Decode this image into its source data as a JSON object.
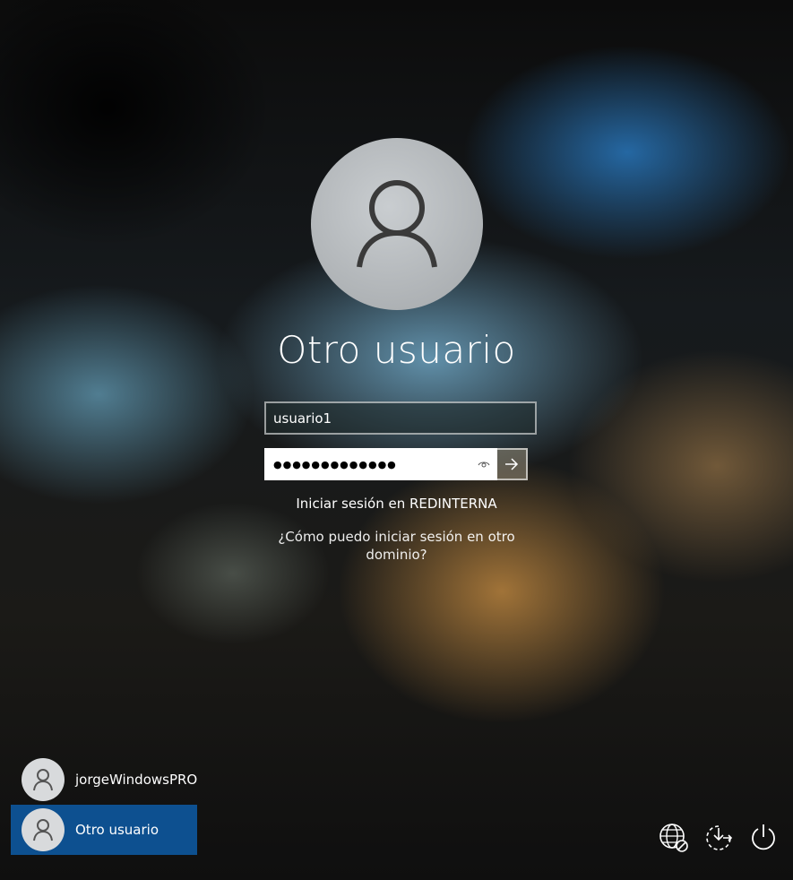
{
  "login": {
    "title": "Otro usuario",
    "username_value": "usuario1",
    "password_mask": "●●●●●●●●●●●●●",
    "domain_text": "Iniciar sesión en REDINTERNA",
    "help_link": "¿Cómo puedo iniciar sesión en otro dominio?"
  },
  "users": [
    {
      "name": "jorgeWindowsPRO",
      "selected": false
    },
    {
      "name": "Otro usuario",
      "selected": true
    }
  ],
  "icons": {
    "avatar": "user-icon",
    "reveal": "eye-icon",
    "submit": "arrow-right-icon",
    "network": "network-icon",
    "accessibility": "accessibility-icon",
    "power": "power-icon"
  },
  "colors": {
    "selected_user_bg": "#0d5090",
    "avatar_bg": "#b4b8bb"
  }
}
